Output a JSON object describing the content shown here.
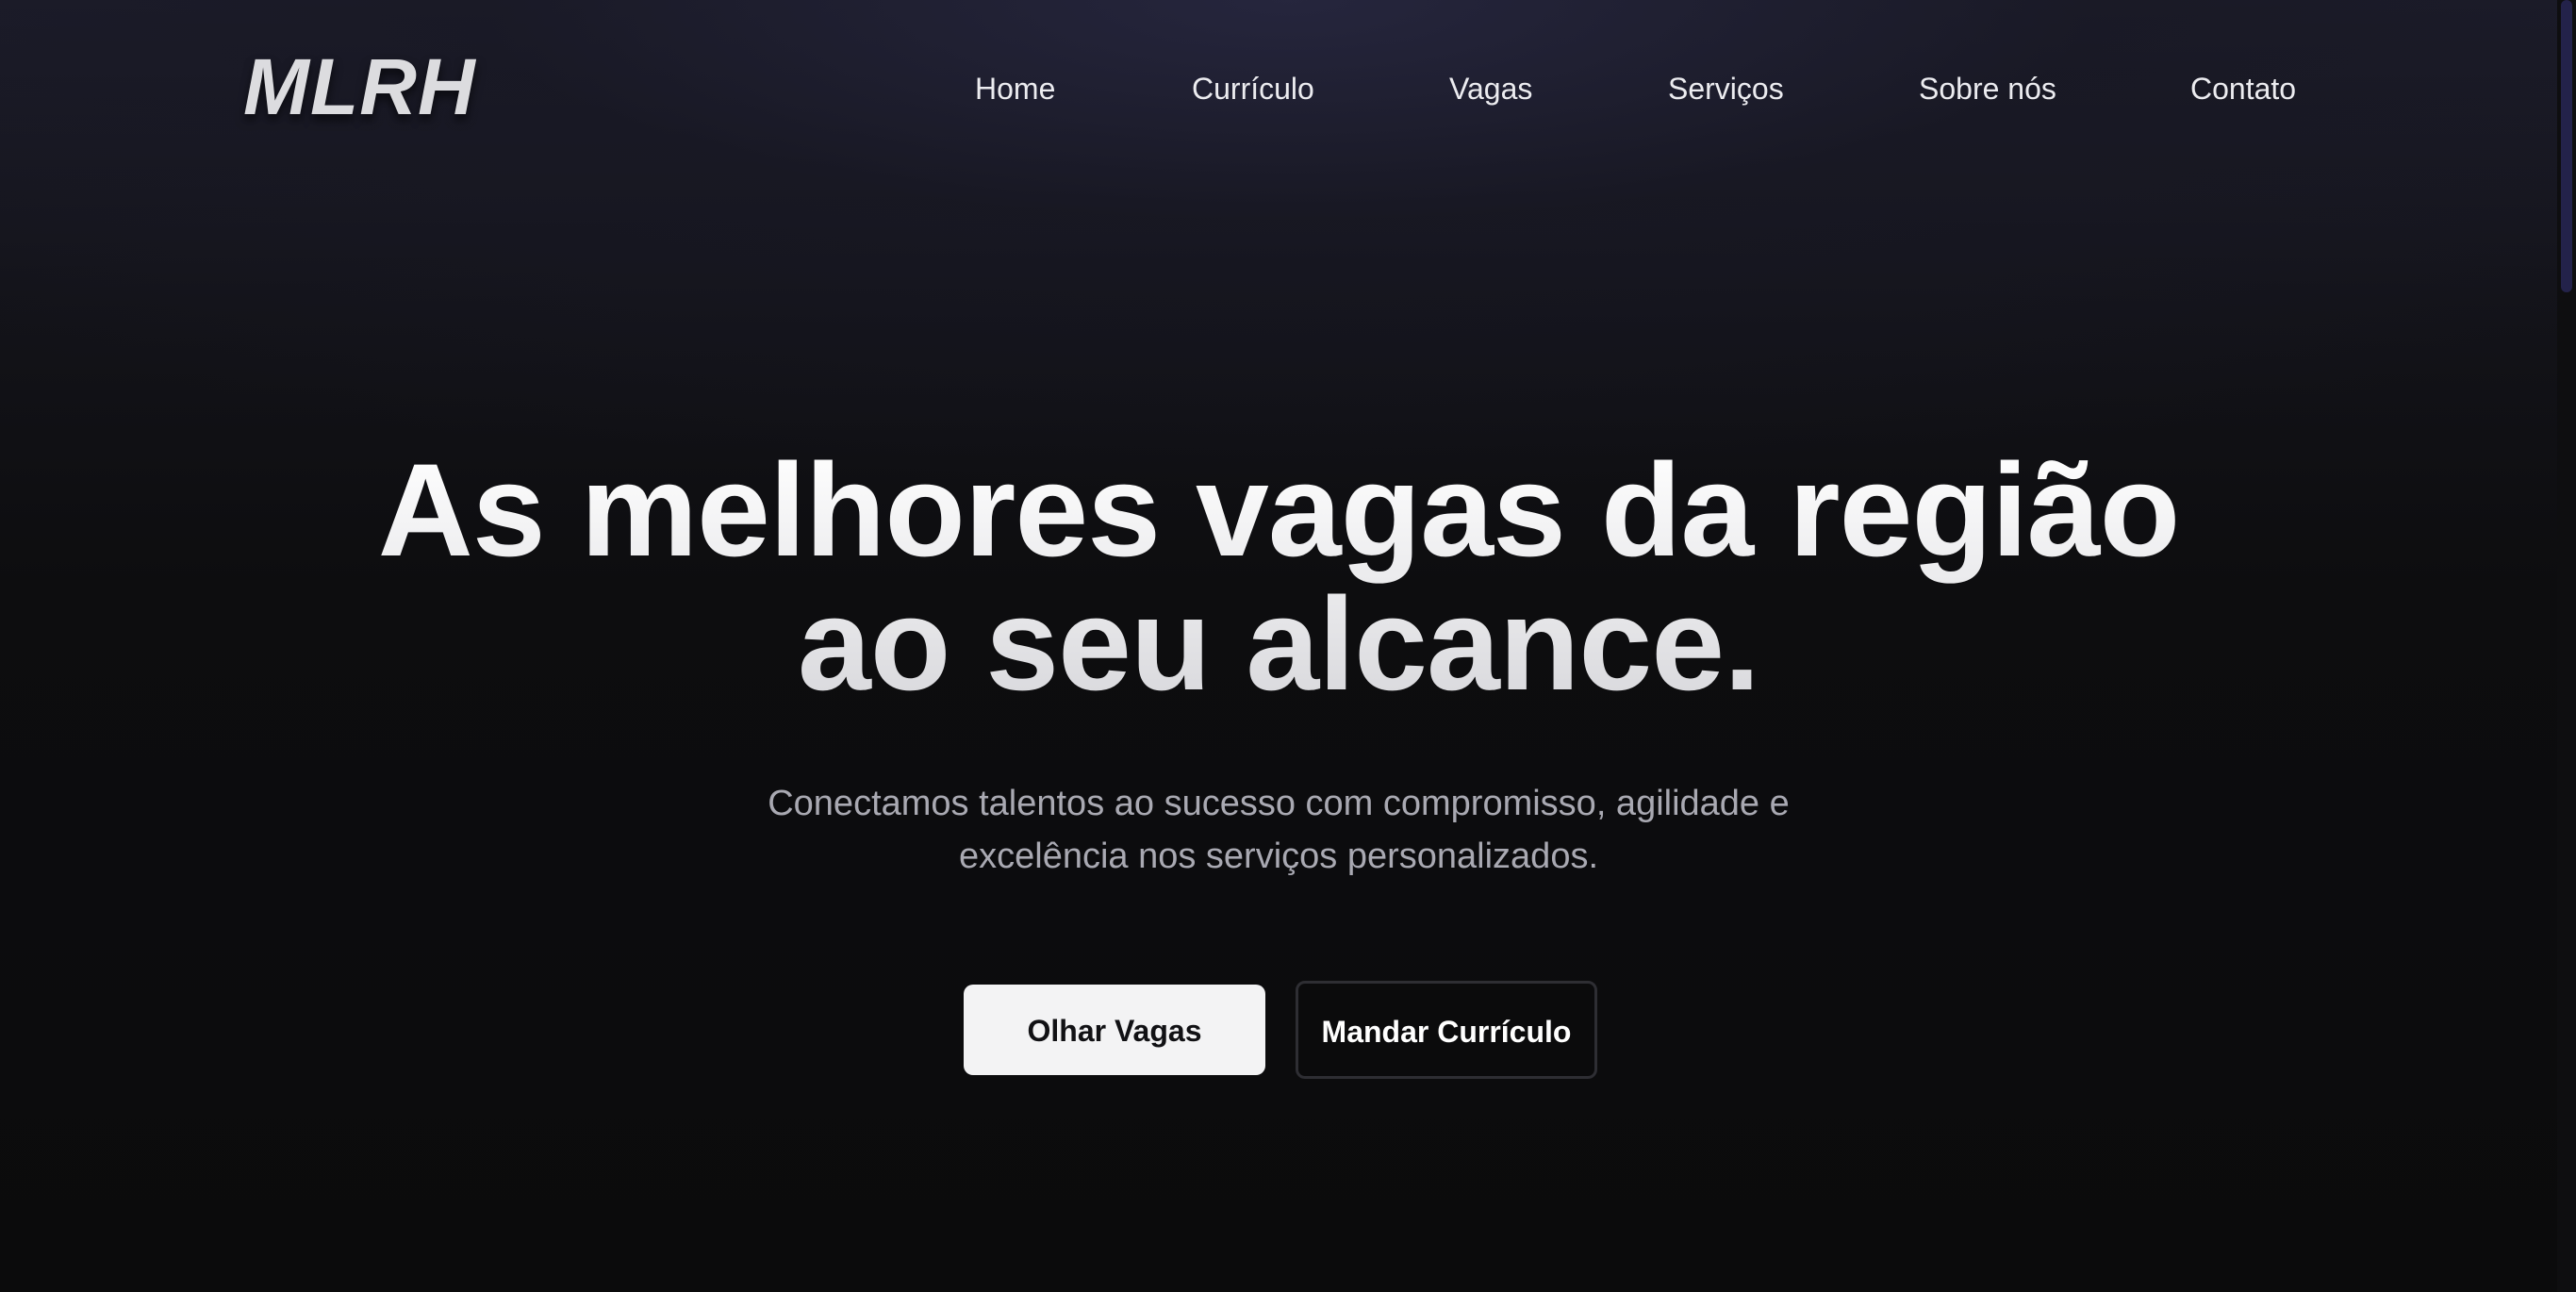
{
  "brand": {
    "logo_text": "MLRH"
  },
  "nav": {
    "items": [
      {
        "label": "Home"
      },
      {
        "label": "Currículo"
      },
      {
        "label": "Vagas"
      },
      {
        "label": "Serviços"
      },
      {
        "label": "Sobre nós"
      },
      {
        "label": "Contato"
      }
    ]
  },
  "hero": {
    "title_line1": "As melhores vagas da região",
    "title_line2": "ao seu alcance.",
    "subtitle_line1": "Conectamos talentos ao sucesso com compromisso, agilidade e",
    "subtitle_line2": "excelência nos serviços personalizados.",
    "primary_cta": "Olhar Vagas",
    "secondary_cta": "Mandar Currículo"
  },
  "colors": {
    "background": "#0b0b0c",
    "header_glow": "#1d1d2b",
    "primary_button_bg": "#f3f3f4",
    "secondary_button_border": "#2e2e33",
    "subtitle_text": "#a9a9b2",
    "scrollbar_thumb": "#23224a"
  }
}
